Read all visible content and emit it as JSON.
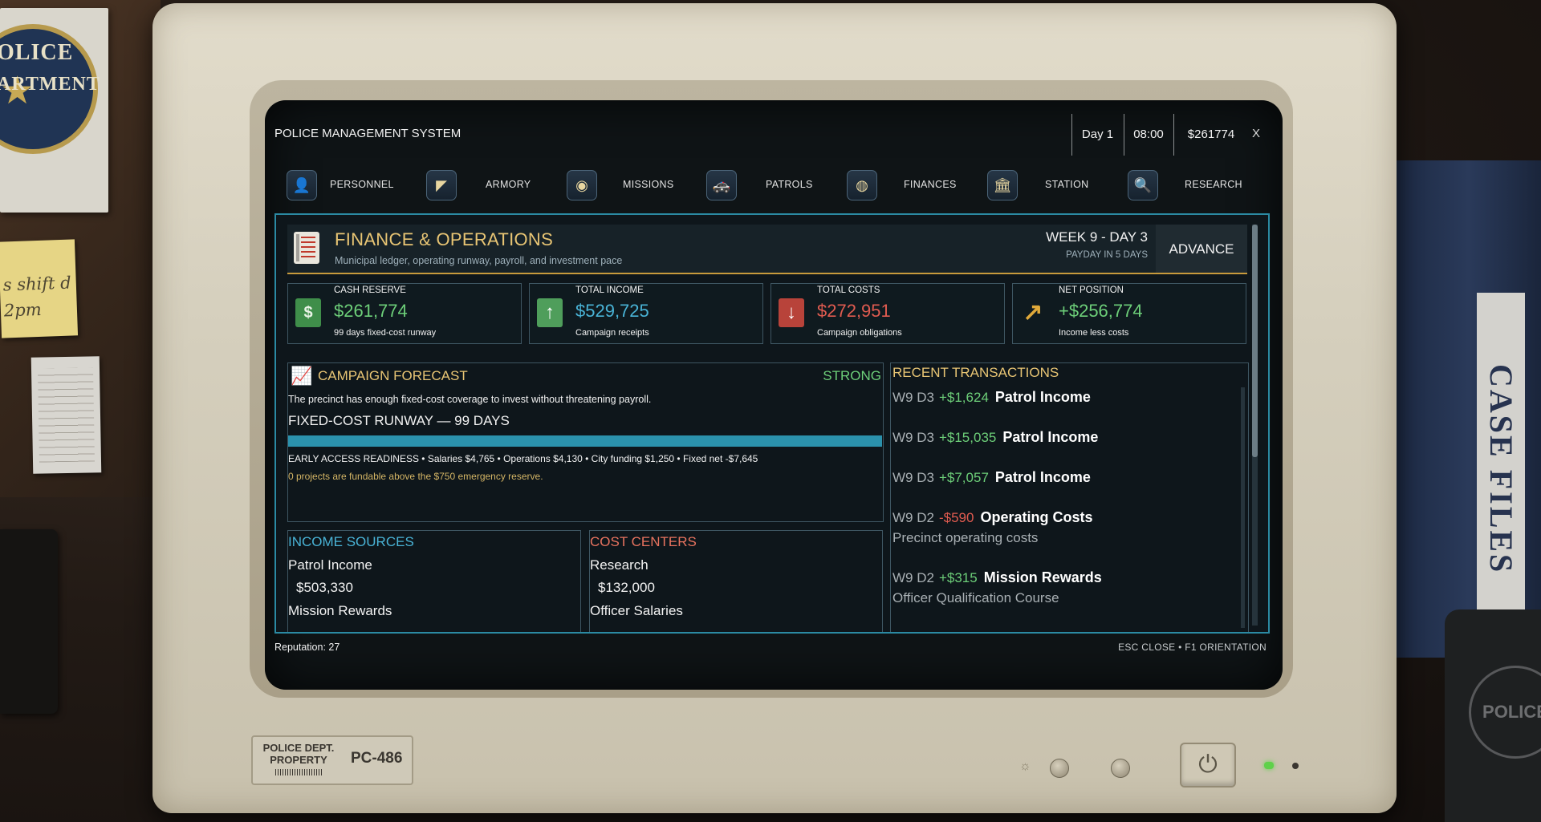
{
  "window": {
    "title": "POLICE MANAGEMENT SYSTEM",
    "day": "Day 1",
    "time": "08:00",
    "money": "$261774",
    "close_label": "X"
  },
  "nav": [
    {
      "label": "PERSONNEL",
      "icon": "person-icon"
    },
    {
      "label": "ARMORY",
      "icon": "gun-icon"
    },
    {
      "label": "MISSIONS",
      "icon": "map-pin-icon"
    },
    {
      "label": "PATROLS",
      "icon": "patrol-car-icon"
    },
    {
      "label": "FINANCES",
      "icon": "coin-icon"
    },
    {
      "label": "STATION",
      "icon": "building-icon"
    },
    {
      "label": "RESEARCH",
      "icon": "magnifier-icon"
    }
  ],
  "header": {
    "title": "FINANCE & OPERATIONS",
    "subtitle": "Municipal ledger, operating runway, payroll, and investment pace",
    "week": "WEEK 9 - DAY 3",
    "payday": "PAYDAY IN 5 DAYS",
    "advance_label": "ADVANCE DAY"
  },
  "cards": [
    {
      "label": "CASH RESERVE",
      "value": "$261,774",
      "sub": "99 days fixed-cost runway",
      "color": "#6dcf79",
      "icon": "cash-icon"
    },
    {
      "label": "TOTAL INCOME",
      "value": "$529,725",
      "sub": "Campaign receipts",
      "color": "#49b3d6",
      "icon": "arrow-up-icon"
    },
    {
      "label": "TOTAL COSTS",
      "value": "$272,951",
      "sub": "Campaign obligations",
      "color": "#e05b50",
      "icon": "arrow-down-icon"
    },
    {
      "label": "NET POSITION",
      "value": "+$256,774",
      "sub": "Income less costs",
      "color": "#6dcf79",
      "icon": "trend-up-icon"
    }
  ],
  "forecast": {
    "title": "CAMPAIGN FORECAST",
    "status": "STRONG",
    "description": "The precinct has enough fixed-cost coverage to invest without threatening payroll.",
    "runway": "FIXED-COST RUNWAY — 99 DAYS",
    "runway_fill_pct": 100,
    "detail": "EARLY ACCESS READINESS • Salaries $4,765 • Operations $4,130 • City funding $1,250 • Fixed net -$7,645",
    "note": "0 projects are fundable above the $750 emergency reserve."
  },
  "transactions": {
    "title": "RECENT TRANSACTIONS",
    "items": [
      {
        "date": "W9 D3",
        "amount": "+$1,624",
        "name": "Patrol Income",
        "sub": "",
        "positive": true
      },
      {
        "date": "W9 D3",
        "amount": "+$15,035",
        "name": "Patrol Income",
        "sub": "",
        "positive": true
      },
      {
        "date": "W9 D3",
        "amount": "+$7,057",
        "name": "Patrol Income",
        "sub": "",
        "positive": true
      },
      {
        "date": "W9 D2",
        "amount": "-$590",
        "name": "Operating Costs",
        "sub": "Precinct operating costs",
        "positive": false
      },
      {
        "date": "W9 D2",
        "amount": "+$315",
        "name": "Mission Rewards",
        "sub": "Officer Qualification Course",
        "positive": true
      }
    ]
  },
  "income_sources": {
    "title": "INCOME SOURCES",
    "items": [
      {
        "name": "Patrol Income",
        "value": "$503,330"
      },
      {
        "name": "Mission Rewards",
        "value": ""
      }
    ]
  },
  "cost_centers": {
    "title": "COST CENTERS",
    "items": [
      {
        "name": "Research",
        "value": "$132,000"
      },
      {
        "name": "Officer Salaries",
        "value": ""
      }
    ]
  },
  "footer": {
    "reputation": "Reputation: 27",
    "hints": "ESC CLOSE  •  F1 ORIENTATION"
  },
  "decor": {
    "poster_text_1": "OLICE",
    "poster_text_2": "ARTMENT",
    "sticky_text": "s shift d 2pm",
    "binder_label": "CASE FILES",
    "mug_text": "POLICE",
    "asset_tag_text": "POLICE DEPT. PROPERTY",
    "model": "PC-486"
  },
  "colors": {
    "accent_gold": "#e8c574",
    "accent_teal": "#2b8aa3",
    "positive": "#6dcf79",
    "negative": "#e05b50",
    "income_blue": "#49b3d6"
  }
}
